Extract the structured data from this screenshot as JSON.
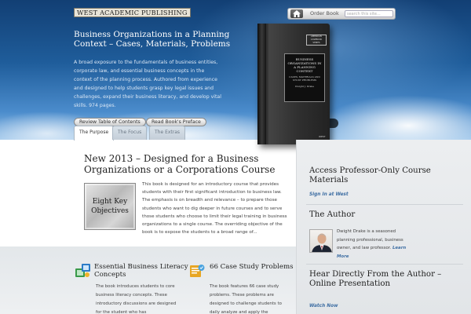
{
  "header": {
    "publisher": "WEST ACADEMIC PUBLISHING",
    "order_link": "Order Book",
    "search_placeholder": "search this site..."
  },
  "hero": {
    "title": "Business Organizations in a Planning Context – Cases, Materials, Problems",
    "description": "A broad exposure to the fundamentals of business entities, corporate law, and essential business concepts in the context of the planning process.  Authored from experience and designed to help students grasp key legal issues and challenges, expand their business literacy, and develop vital skills. 974 pages.",
    "buttons": {
      "toc": "Review Table of Contents",
      "preface": "Read Book's Preface"
    },
    "carousel": {
      "count": 7,
      "active_index": 0
    }
  },
  "book_cover": {
    "series": "AMERICAN CASEBOOK SERIES",
    "title": "BUSINESS ORGANIZATIONS IN A PLANNING CONTEXT",
    "subtitle": "CASES, MATERIALS AND STUDY PROBLEMS",
    "author": "Dwight J. Drake",
    "imprint": "WEST"
  },
  "tabs": [
    {
      "label": "The Purpose",
      "active": true
    },
    {
      "label": "The Focus",
      "active": false
    },
    {
      "label": "The Extras",
      "active": false
    }
  ],
  "main": {
    "heading": "New 2013 – Designed for a Business Organizations or a Corporations Course",
    "key_box": "Eight Key Objectives",
    "body": "This book is designed for an introductory course that provides students with their first significant introduction to business law.  The emphasis is on breadth and relevance – to prepare those students who want to dig deeper in future courses and to serve those students who choose to limit their legal training in business organizations to a single course. The overriding objective of the book is to expose the students to a broad range of..."
  },
  "features": [
    {
      "icon": "literacy-icon",
      "title": "Essential Business Literacy Concepts",
      "body": "The book introduces students to core business literacy concepts. These introductory discussions are designed for the student who has"
    },
    {
      "icon": "case-study-icon",
      "title": "66 Case Study Problems",
      "body": "The book features 66 case study problems.  These problems are designed to challenge students to daily analyze and apply the"
    }
  ],
  "sidebar": {
    "access": {
      "title": "Access Professor-Only Course Materials",
      "link": "Sign In at West"
    },
    "author": {
      "title": "The Author",
      "bio": "Dwight Drake is a seasoned planning professional, business owner, and law professor.",
      "more": "Learn More"
    },
    "hear": {
      "title": "Hear Directly From the Author – Online Presentation",
      "link": "Watch Now"
    }
  },
  "colors": {
    "hero_top": "#123f74",
    "hero_bottom": "#9cc5ea",
    "link": "#3e6ea3",
    "sidebar_bg": "#eceef0"
  }
}
